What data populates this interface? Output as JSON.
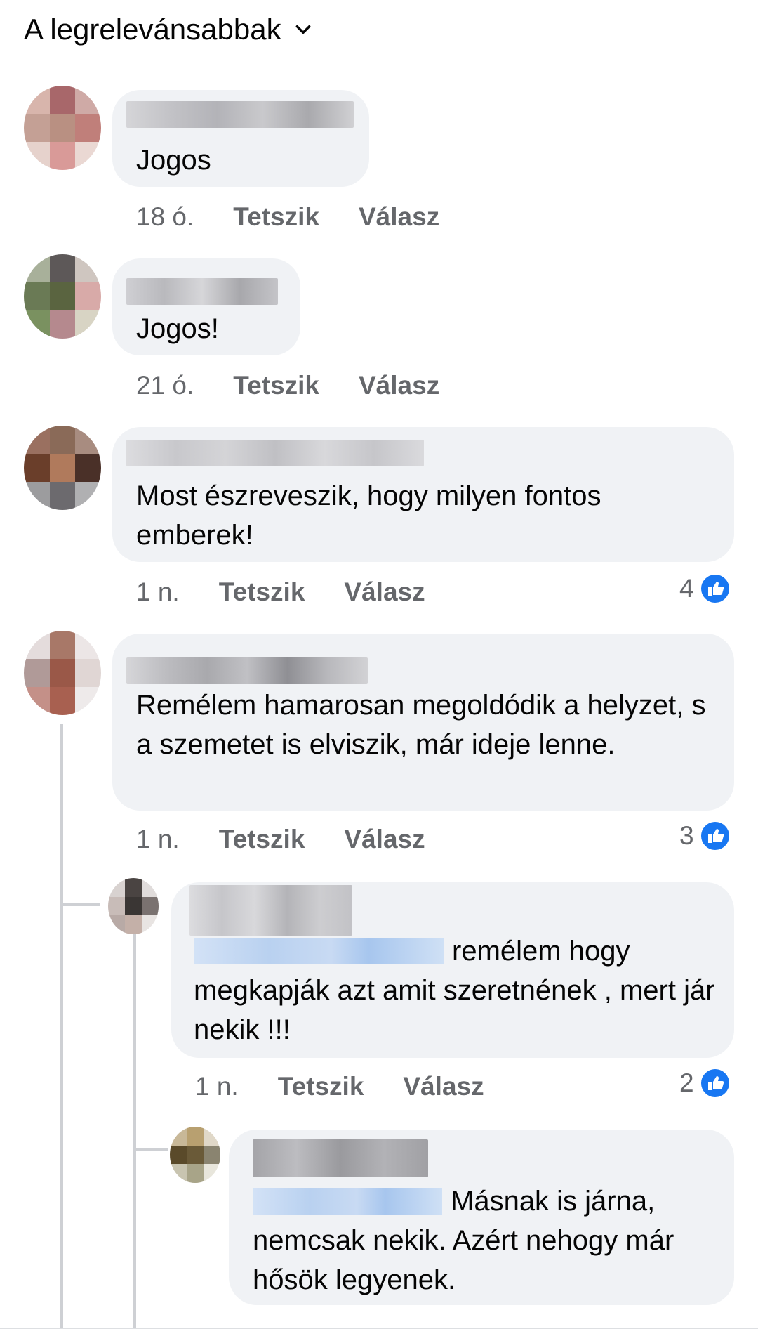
{
  "sort": {
    "label": "A legrelevánsabbak"
  },
  "comments": [
    {
      "text": "Jogos",
      "time": "18 ó.",
      "like": "Tetszik",
      "reply": "Válasz",
      "reactions": ""
    },
    {
      "text": "Jogos!",
      "time": "21 ó.",
      "like": "Tetszik",
      "reply": "Válasz",
      "reactions": ""
    },
    {
      "text": "Most észreveszik, hogy milyen fontos emberek!",
      "time": "1 n.",
      "like": "Tetszik",
      "reply": "Válasz",
      "reactions": "4"
    },
    {
      "text": "Remélem hamarosan megoldódik a helyzet, s a szemetet is elviszik, már ideje lenne.",
      "time": "1 n.",
      "like": "Tetszik",
      "reply": "Válasz",
      "reactions": "3"
    },
    {
      "text_after_mention": "remélem hogy megkapják azt amit szeretnének , mert jár nekik !!!",
      "time": "1 n.",
      "like": "Tetszik",
      "reply": "Válasz",
      "reactions": "2"
    },
    {
      "text_after_mention": "Másnak is járna, nemcsak nekik. Azért nehogy már hősök legyenek."
    }
  ],
  "colors": {
    "bubble": "#f0f2f5",
    "meta": "#65676b",
    "like_blue": "#1877f2"
  },
  "icons": {
    "sort": "chevron-down-icon",
    "reaction": "like-icon"
  }
}
